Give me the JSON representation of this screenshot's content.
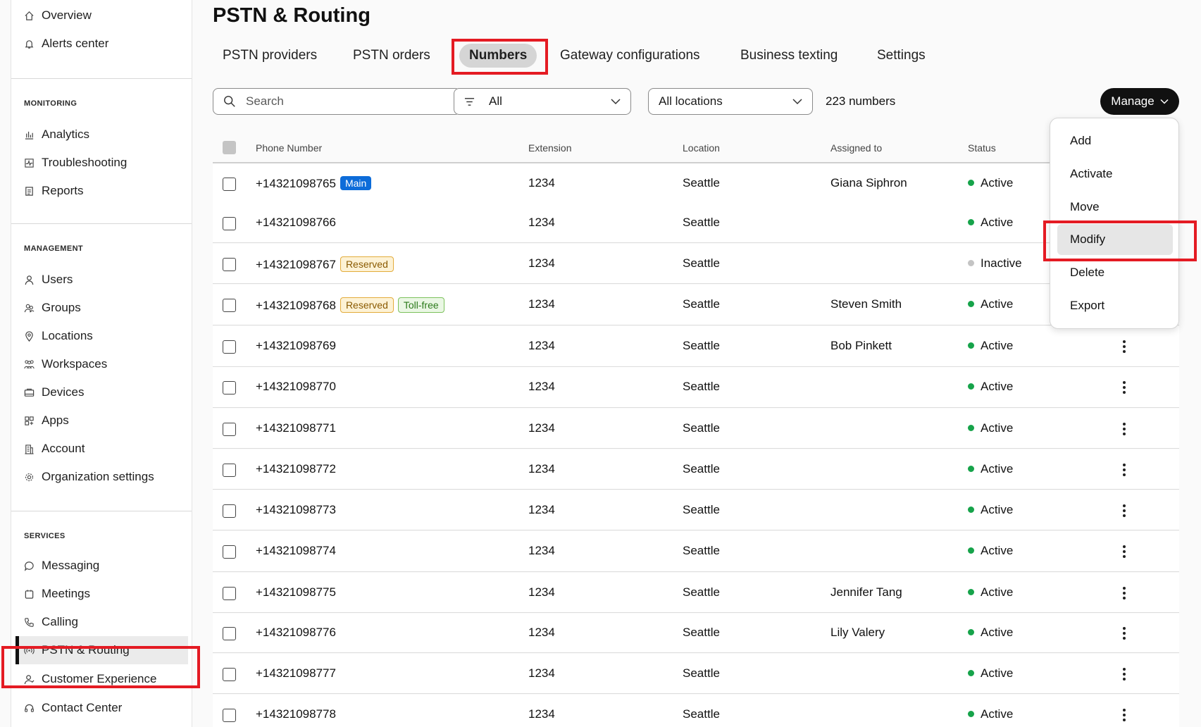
{
  "sidebar": {
    "top_items": [
      {
        "label": "Overview",
        "icon": "home-icon"
      },
      {
        "label": "Alerts center",
        "icon": "bell-icon"
      }
    ],
    "sections": [
      {
        "title": "MONITORING",
        "items": [
          {
            "label": "Analytics",
            "icon": "bar-chart-icon"
          },
          {
            "label": "Troubleshooting",
            "icon": "pulse-icon"
          },
          {
            "label": "Reports",
            "icon": "report-icon"
          }
        ]
      },
      {
        "title": "MANAGEMENT",
        "items": [
          {
            "label": "Users",
            "icon": "user-icon"
          },
          {
            "label": "Groups",
            "icon": "group-icon"
          },
          {
            "label": "Locations",
            "icon": "location-pin-icon"
          },
          {
            "label": "Workspaces",
            "icon": "workspace-icon"
          },
          {
            "label": "Devices",
            "icon": "device-icon"
          },
          {
            "label": "Apps",
            "icon": "apps-icon"
          },
          {
            "label": "Account",
            "icon": "building-icon"
          },
          {
            "label": "Organization settings",
            "icon": "gear-icon"
          }
        ]
      },
      {
        "title": "SERVICES",
        "items": [
          {
            "label": "Messaging",
            "icon": "chat-bubble-icon"
          },
          {
            "label": "Meetings",
            "icon": "calendar-icon"
          },
          {
            "label": "Calling",
            "icon": "phone-icon"
          },
          {
            "label": "PSTN & Routing",
            "icon": "signal-icon",
            "active": true
          },
          {
            "label": "Customer Experience",
            "icon": "customer-icon"
          },
          {
            "label": "Contact Center",
            "icon": "headset-icon"
          }
        ]
      }
    ]
  },
  "page": {
    "title": "PSTN & Routing",
    "tabs": [
      "PSTN providers",
      "PSTN  orders",
      "Numbers",
      "Gateway configurations",
      "Business texting",
      "Settings"
    ],
    "selected_tab": "Numbers"
  },
  "toolbar": {
    "search_placeholder": "Search",
    "filter_value": "All",
    "location_value": "All locations",
    "count_text": "223 numbers",
    "manage_label": "Manage"
  },
  "table": {
    "columns": [
      "Phone Number",
      "Extension",
      "Location",
      "Assigned to",
      "Status"
    ],
    "rows": [
      {
        "phone": "+14321098765",
        "badges": [
          {
            "text": "Main",
            "kind": "main"
          }
        ],
        "ext": "1234",
        "location": "Seattle",
        "assigned": "Giana Siphron",
        "status": "Active"
      },
      {
        "phone": "+14321098766",
        "badges": [],
        "ext": "1234",
        "location": "Seattle",
        "assigned": "",
        "status": "Active"
      },
      {
        "phone": "+14321098767",
        "badges": [
          {
            "text": "Reserved",
            "kind": "reserved"
          }
        ],
        "ext": "1234",
        "location": "Seattle",
        "assigned": "",
        "status": "Inactive"
      },
      {
        "phone": "+14321098768",
        "badges": [
          {
            "text": "Reserved",
            "kind": "reserved"
          },
          {
            "text": "Toll-free",
            "kind": "tollfree"
          }
        ],
        "ext": "1234",
        "location": "Seattle",
        "assigned": "Steven Smith",
        "status": "Active"
      },
      {
        "phone": "+14321098769",
        "badges": [],
        "ext": "1234",
        "location": "Seattle",
        "assigned": "Bob Pinkett",
        "status": "Active"
      },
      {
        "phone": "+14321098770",
        "badges": [],
        "ext": "1234",
        "location": "Seattle",
        "assigned": "",
        "status": "Active"
      },
      {
        "phone": "+14321098771",
        "badges": [],
        "ext": "1234",
        "location": "Seattle",
        "assigned": "",
        "status": "Active"
      },
      {
        "phone": "+14321098772",
        "badges": [],
        "ext": "1234",
        "location": "Seattle",
        "assigned": "",
        "status": "Active"
      },
      {
        "phone": "+14321098773",
        "badges": [],
        "ext": "1234",
        "location": "Seattle",
        "assigned": "",
        "status": "Active"
      },
      {
        "phone": "+14321098774",
        "badges": [],
        "ext": "1234",
        "location": "Seattle",
        "assigned": "",
        "status": "Active"
      },
      {
        "phone": "+14321098775",
        "badges": [],
        "ext": "1234",
        "location": "Seattle",
        "assigned": "Jennifer Tang",
        "status": "Active"
      },
      {
        "phone": "+14321098776",
        "badges": [],
        "ext": "1234",
        "location": "Seattle",
        "assigned": "Lily Valery",
        "status": "Active"
      },
      {
        "phone": "+14321098777",
        "badges": [],
        "ext": "1234",
        "location": "Seattle",
        "assigned": "",
        "status": "Active"
      },
      {
        "phone": "+14321098778",
        "badges": [],
        "ext": "1234",
        "location": "Seattle",
        "assigned": "",
        "status": "Active"
      }
    ]
  },
  "manage_menu": {
    "items": [
      "Add",
      "Activate",
      "Move",
      "Modify",
      "Delete",
      "Export"
    ],
    "hovered": "Modify"
  },
  "colors": {
    "active_status": "#16a34a",
    "inactive_status": "#c4c4c4",
    "highlight": "#e41b23",
    "main_badge": "#0d6cd9"
  }
}
